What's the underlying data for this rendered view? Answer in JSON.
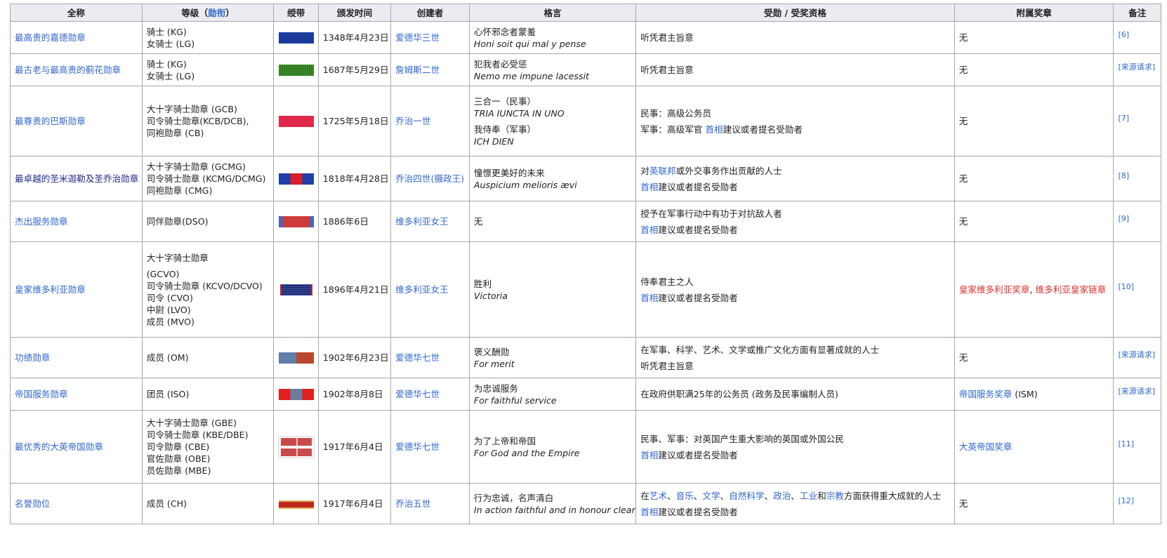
{
  "headers": {
    "name": "全称",
    "grade_prefix": "等级（",
    "grade_link": "勋衔",
    "grade_suffix": "）",
    "ribbon": "绶带",
    "date": "颁发时间",
    "founder": "创建者",
    "motto": "格言",
    "eligibility": "受勋 / 受奖资格",
    "awards": "附属奖章",
    "notes": "备注"
  },
  "rows": [
    {
      "name": "最高贵的嘉德勋章",
      "grades": [
        "骑士 (KG)",
        "女骑士 (LG)"
      ],
      "ribbon": "garter-ribbon",
      "date": "1348年4月23日",
      "founder": "爱德华三世",
      "motto_zh": "心怀邪念者蒙羞",
      "motto_orig": "Honi soit qui mal y pense",
      "eligibility": [
        "听凭君主旨意"
      ],
      "awards": "无",
      "note": "[6]"
    },
    {
      "name": "最古老与最高贵的蓟花勋章",
      "grades": [
        "骑士 (KG)",
        "女骑士 (LG)"
      ],
      "ribbon": "thistle-ribbon",
      "date": "1687年5月29日",
      "founder": "詹姆斯二世",
      "motto_zh": "犯我者必受惩",
      "motto_orig": "Nemo me impune lacessit",
      "eligibility": [
        "听凭君主旨意"
      ],
      "awards": "无",
      "note": "[来源请求]"
    },
    {
      "name": "最尊贵的巴斯勋章",
      "grades": [
        "大十字骑士勋章 (GCB)",
        "司令骑士勋章(KCB/DCB),",
        "同袍勋章 (CB)"
      ],
      "ribbon": "bath-ribbon",
      "date": "1725年5月18日",
      "founder": "乔治一世",
      "motto_zh": "三合一（民事）",
      "motto_orig": "TRIA IUNCTA IN UNO",
      "motto2_zh": "我侍奉（军事）",
      "motto2_orig": "ICH DIEN",
      "eligibility_civil": "民事：高级公务员",
      "eligibility_mil_prefix": "军事：高级军官 ",
      "eligibility_mil_link": "首相",
      "eligibility_mil_suffix": "建议或者提名受勋者",
      "awards": "无",
      "note": "[7]"
    },
    {
      "name": "最卓越的圣米迦勒及圣乔治勋章",
      "grades": [
        "大十字骑士勋章 (GCMG)",
        "司令骑士勋章 (KCMG/DCMG)",
        "同袍勋章 (CMG)"
      ],
      "ribbon": "smsg-ribbon",
      "date": "1818年4月28日",
      "founder": "乔治四世(摄政王)",
      "motto_zh": "憧憬更美好的未来",
      "motto_orig": "Auspicium melioris ævi",
      "elig1_prefix": "对",
      "elig1_link": "英联邦",
      "elig1_suffix": "或外交事务作出贡献的人士",
      "elig2_link": "首相",
      "elig2_suffix": "建议或者提名受勋者",
      "awards": "无",
      "note": "[8]"
    },
    {
      "name": "杰出服务勋章",
      "grades": [
        "同伴勋章(DSO)"
      ],
      "ribbon": "dso-ribbon",
      "date": "1886年6日",
      "founder": "维多利亚女王",
      "motto_zh": "无",
      "elig1": "授予在军事行动中有功于对抗敌人者",
      "elig2_link": "首相",
      "elig2_suffix": "建议或者提名受勋者",
      "awards": "无",
      "note": "[9]"
    },
    {
      "name": "皇家维多利亚勋章",
      "grades": [
        "大十字骑士勋章",
        "(GCVO)",
        "司令骑士勋章 (KCVO/DCVO)",
        "司令 (CVO)",
        "中尉 (LVO)",
        "成员 (MVO)"
      ],
      "ribbon": "rvo-ribbon",
      "date": "1896年4月21日",
      "founder": "维多利亚女王",
      "motto_zh": "胜利",
      "motto_orig": "Victoria",
      "elig1": "侍奉君主之人",
      "elig2_link": "首相",
      "elig2_suffix": "建议或者提名受勋者",
      "awards_red1": "皇家维多利亚奖章",
      "awards_sep": ",",
      "awards_red2": "维多利亚皇家链章",
      "note": "[10]"
    },
    {
      "name": "功绩勋章",
      "grades": [
        "成员 (OM)"
      ],
      "ribbon": "om-ribbon",
      "date": "1902年6月23日",
      "founder": "爱德华七世",
      "motto_zh": "褒义酬勋",
      "motto_orig": "For merit",
      "elig1": "在军事、科学、艺术、文学或推广文化方面有显著成就的人士",
      "elig2": "听凭君主旨意",
      "awards": "无",
      "note": "[来源请求]"
    },
    {
      "name": "帝国服务勋章",
      "grades": [
        "团员 (ISO)"
      ],
      "ribbon": "iso-ribbon",
      "date": "1902年8月8日",
      "founder": "爱德华七世",
      "motto_zh": "为忠诚服务",
      "motto_orig": "For faithful service",
      "elig1": "在政府供职满25年的公务员 (政务及民事编制人员)",
      "awards_link": "帝国服务奖章",
      "awards_suffix": " (ISM)",
      "note": "[来源请求]"
    },
    {
      "name": "最优秀的大英帝国勋章",
      "grades": [
        "大十字骑士勋章 (GBE)",
        "司令骑士勋章 (KBE/DBE)",
        "司令勋章 (CBE)",
        "官佐勋章 (OBE)",
        "员佐勋章 (MBE)"
      ],
      "ribbon": "obe-ribbon",
      "date": "1917年6月4日",
      "founder": "爱德华七世",
      "motto_zh": "为了上帝和帝国",
      "motto_orig": "For God and the Empire",
      "elig1": "民事、军事：对英国产生重大影响的英国或外国公民",
      "elig2_link": "首相",
      "elig2_suffix": "建议或者提名受勋者",
      "awards_link": "大英帝国奖章",
      "note": "[11]"
    },
    {
      "name": "名誉勋位",
      "grades": [
        "成员 (CH)"
      ],
      "ribbon": "ch-ribbon",
      "date": "1917年6月4日",
      "founder": "乔治五世",
      "motto_zh": "行为忠诚，名声清白",
      "motto_orig": "In action faithful and in honour clear",
      "elig_a": "在",
      "elig_l1": "艺术",
      "elig_s1": "、",
      "elig_l2": "音乐",
      "elig_s2": "、",
      "elig_l3": "文学",
      "elig_s3": "、",
      "elig_l4": "自然科学",
      "elig_s4": "、",
      "elig_l5": "政治",
      "elig_s5": "、",
      "elig_l6": "工业",
      "elig_s6": "和",
      "elig_l7": "宗教",
      "elig_s7": "方面获得重大成就的人士",
      "elig2_link": "首相",
      "elig2_suffix": "建议或者提名受勋者",
      "awards": "无",
      "note": "[12]"
    }
  ],
  "colors": {
    "link": "#3366cc",
    "redlink": "#d73333",
    "header_bg": "#eaecf0",
    "border": "#a2a9b1"
  }
}
